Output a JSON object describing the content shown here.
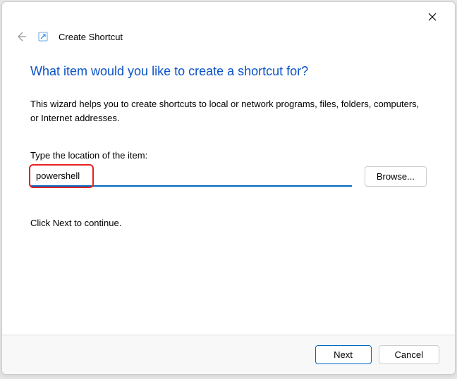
{
  "window": {
    "title": "Create Shortcut"
  },
  "wizard": {
    "heading": "What item would you like to create a shortcut for?",
    "description": "This wizard helps you to create shortcuts to local or network programs, files, folders, computers, or Internet addresses.",
    "field_label": "Type the location of the item:",
    "location_value": "powershell",
    "browse_label": "Browse...",
    "continue_text": "Click Next to continue."
  },
  "footer": {
    "next_label": "Next",
    "cancel_label": "Cancel"
  }
}
